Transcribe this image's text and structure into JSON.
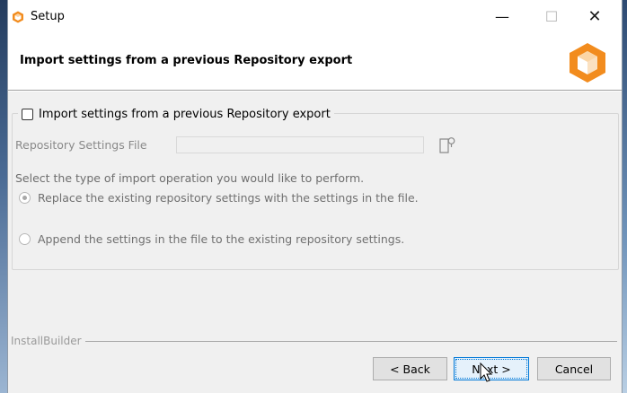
{
  "window": {
    "title": "Setup",
    "controls": {
      "minimize": "—",
      "maximize": "☐",
      "close": "✕"
    }
  },
  "header": {
    "title": "Import settings from a previous Repository export"
  },
  "options": {
    "import_checkbox_label": "Import settings from a previous Repository export",
    "import_checked": false,
    "file_label": "Repository Settings File",
    "file_value": "",
    "instruction": "Select the type of import operation you would like to perform.",
    "radios": [
      {
        "label": "Replace the existing repository settings with the settings in the file.",
        "selected": true
      },
      {
        "label": "Append the settings in the file to the existing repository settings.",
        "selected": false
      }
    ]
  },
  "footer": {
    "brand": "InstallBuilder",
    "back_label": "< Back",
    "next_label": "Next >",
    "cancel_label": "Cancel"
  },
  "colors": {
    "brand_orange": "#f28c1e",
    "focus_blue": "#0078d7",
    "window_bg": "#f0f0f0"
  }
}
